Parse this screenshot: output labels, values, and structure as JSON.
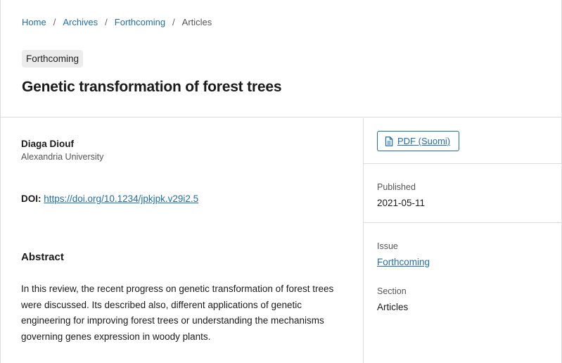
{
  "breadcrumb": {
    "home": "Home",
    "archives": "Archives",
    "forthcoming": "Forthcoming",
    "current": "Articles",
    "separator": "/"
  },
  "badge": "Forthcoming",
  "title": "Genetic transformation of forest trees",
  "author": {
    "name": "Diaga Diouf",
    "affiliation": "Alexandria University"
  },
  "doi": {
    "label": "DOI:",
    "url": "https://doi.org/10.1234/jpkjpk.v29i2.5"
  },
  "abstract": {
    "heading": "Abstract",
    "text": "In this review, the recent progress on genetic transformation of forest trees were discussed. Its described also, different applications of genetic engineering for improving forest trees or understanding the mechanisms governing genes expression in woody plants."
  },
  "sidebar": {
    "pdf_label": "PDF (Suomi)",
    "pdf_icon": "document-icon",
    "published_label": "Published",
    "published_value": "2021-05-11",
    "issue_label": "Issue",
    "issue_value": "Forthcoming",
    "section_label": "Section",
    "section_value": "Articles"
  },
  "colors": {
    "link": "#1f6fa8",
    "border": "#dcdcdc",
    "badge_bg": "#ececec"
  }
}
